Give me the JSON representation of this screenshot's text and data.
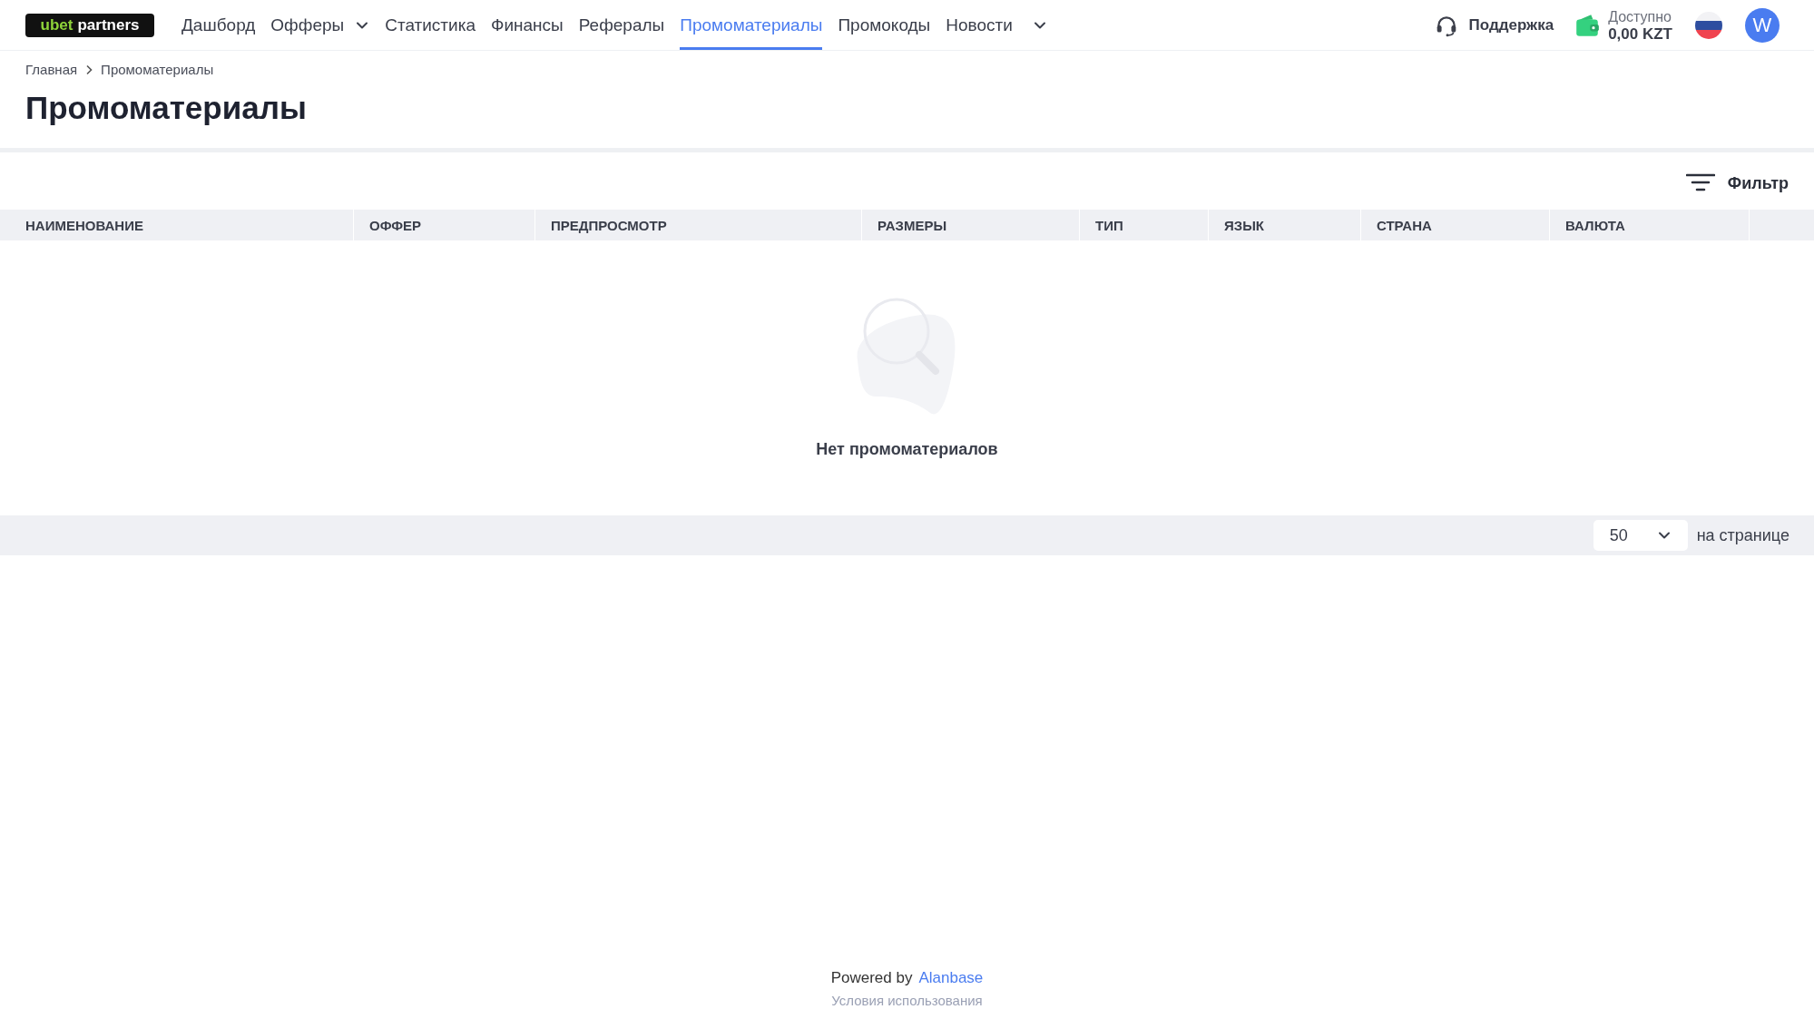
{
  "header": {
    "logo": {
      "accent": "ubet",
      "text": "partners"
    },
    "nav": [
      {
        "label": "Дашборд",
        "selected": false,
        "has_menu": false
      },
      {
        "label": "Офферы",
        "selected": false,
        "has_menu": true
      },
      {
        "label": "Статистика",
        "selected": false,
        "has_menu": false
      },
      {
        "label": "Финансы",
        "selected": false,
        "has_menu": false
      },
      {
        "label": "Рефералы",
        "selected": false,
        "has_menu": false
      },
      {
        "label": "Промоматериалы",
        "selected": true,
        "has_menu": false
      },
      {
        "label": "Промокоды",
        "selected": false,
        "has_menu": false
      },
      {
        "label": "Новости",
        "selected": false,
        "has_menu": true
      }
    ],
    "support": "Поддержка",
    "balance": {
      "label": "Доступно",
      "amount": "0,00 KZT"
    },
    "avatar": "W"
  },
  "breadcrumbs": [
    "Главная",
    "Промоматериалы"
  ],
  "title": "Промоматериалы",
  "filter": "Фильтр",
  "table": {
    "columns": [
      "НАИМЕНОВАНИЕ",
      "ОФФЕР",
      "ПРЕДПРОСМОТР",
      "РАЗМЕРЫ",
      "ТИП",
      "ЯЗЫК",
      "СТРАНА",
      "ВАЛЮТА"
    ],
    "empty": "Нет промоматериалов"
  },
  "pagination": {
    "per_page": "50",
    "label": "на странице"
  },
  "footer": {
    "powered": "Powered by",
    "link": "Alanbase",
    "terms": "Условия использования"
  }
}
